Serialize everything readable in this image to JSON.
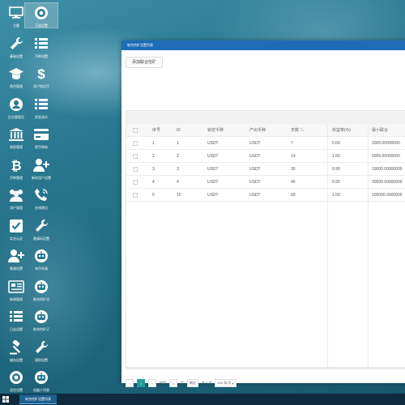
{
  "desktop": {
    "icons": [
      {
        "label": "主题",
        "icon": "monitor-icon"
      },
      {
        "label": "订阅设置",
        "icon": "settings-wheel-icon"
      },
      {
        "label": "基础设置",
        "icon": "wrench-icon"
      },
      {
        "label": "币种设置",
        "icon": "list-icon"
      },
      {
        "label": "角色管理",
        "icon": "graduation-cap-icon"
      },
      {
        "label": "用户钱包币",
        "icon": "dollar-icon"
      },
      {
        "label": "后台管理员",
        "icon": "user-circle-icon"
      },
      {
        "label": "资金流水",
        "icon": "list-icon"
      },
      {
        "label": "商家管理",
        "icon": "bank-icon"
      },
      {
        "label": "提币审核",
        "icon": "credit-card-icon"
      },
      {
        "label": "币种管理",
        "icon": "bitcoin-icon"
      },
      {
        "label": "新的用户设置",
        "icon": "user-plus-icon"
      },
      {
        "label": "用户管理",
        "icon": "users-icon"
      },
      {
        "label": "在线建议",
        "icon": "phone-icon"
      },
      {
        "label": "实名认证",
        "icon": "check-square-icon"
      },
      {
        "label": "邀请码设置",
        "icon": "wrench-icon"
      },
      {
        "label": "邀请设置",
        "icon": "user-plus-icon"
      },
      {
        "label": "充币申请",
        "icon": "robot-icon"
      },
      {
        "label": "新闻管理",
        "icon": "newspaper-icon"
      },
      {
        "label": "联合挖矿设",
        "icon": "robot-icon"
      },
      {
        "label": "日志设置",
        "icon": "list-icon"
      },
      {
        "label": "联合挖矿订",
        "icon": "robot-icon"
      },
      {
        "label": "服务设置",
        "icon": "gavel-icon"
      },
      {
        "label": "理财设置",
        "icon": "wrench-icon"
      },
      {
        "label": "语言设置",
        "icon": "settings-wheel-icon"
      },
      {
        "label": "机器人列表",
        "icon": "robot-icon"
      }
    ]
  },
  "window": {
    "title": "联合挖矿设置列表",
    "add_button": "添加联合挖矿",
    "columns": [
      "序号",
      "ID",
      "锁定币种",
      "产出币种",
      "天数",
      "收益率(%)",
      "最小联合"
    ],
    "rows": [
      [
        "1",
        "1",
        "USDT",
        "USDT",
        "7",
        "0.60",
        "2000.00000000"
      ],
      [
        "2",
        "2",
        "USDT",
        "USDT",
        "14",
        "1.50",
        "5000.00000000"
      ],
      [
        "3",
        "3",
        "USDT",
        "USDT",
        "30",
        "0.90",
        "10000.00000000"
      ],
      [
        "4",
        "4",
        "USDT",
        "USDT",
        "45",
        "0.95",
        "30000.00000000"
      ],
      [
        "5",
        "10",
        "USDT",
        "USDT",
        "60",
        "1.00",
        "100000.0000000"
      ]
    ],
    "footer_label": "小计",
    "pager": {
      "prev": "‹",
      "current": "1",
      "next": "›",
      "goto_label": "到第",
      "page_value": "1",
      "page_unit": "页",
      "confirm": "确定",
      "total": "共 5 条",
      "per_page": "100 条/页"
    }
  },
  "taskbar": {
    "task_label": "联合挖矿设置列表"
  }
}
